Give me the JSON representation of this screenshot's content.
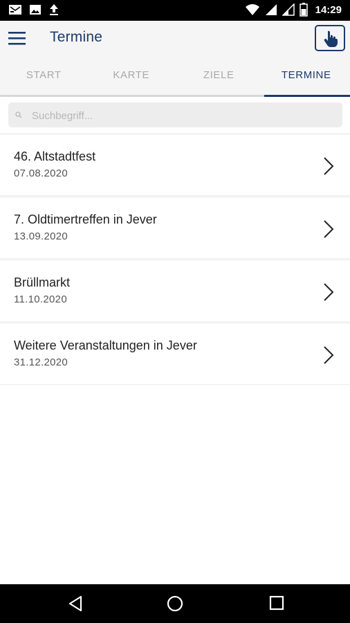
{
  "status_bar": {
    "time": "14:29",
    "left_icons": [
      "notification-icon",
      "image-icon",
      "upload-icon"
    ],
    "right_icons": [
      "wifi-icon",
      "signal-icon",
      "signal-icon",
      "battery-icon"
    ]
  },
  "app_bar": {
    "title": "Termine",
    "menu_icon": "hamburger-menu-icon",
    "action_icon": "hand-pointer-icon"
  },
  "tabs": [
    {
      "label": "START",
      "active": false
    },
    {
      "label": "KARTE",
      "active": false
    },
    {
      "label": "ZIELE",
      "active": false
    },
    {
      "label": "TERMINE",
      "active": true
    }
  ],
  "search": {
    "placeholder": "Suchbegriff...",
    "value": ""
  },
  "events": [
    {
      "title": "46. Altstadtfest",
      "date": "07.08.2020"
    },
    {
      "title": "7. Oldtimertreffen in Jever",
      "date": "13.09.2020"
    },
    {
      "title": "Brüllmarkt",
      "date": "11.10.2020"
    },
    {
      "title": "Weitere Veranstaltungen in Jever",
      "date": "31.12.2020"
    }
  ],
  "nav_bar": {
    "buttons": [
      "back-icon",
      "home-icon",
      "recents-icon"
    ]
  },
  "colors": {
    "accent": "#1b3a6b",
    "tab_inactive": "#a9a9a9",
    "header_bg": "#f5f5f5"
  }
}
